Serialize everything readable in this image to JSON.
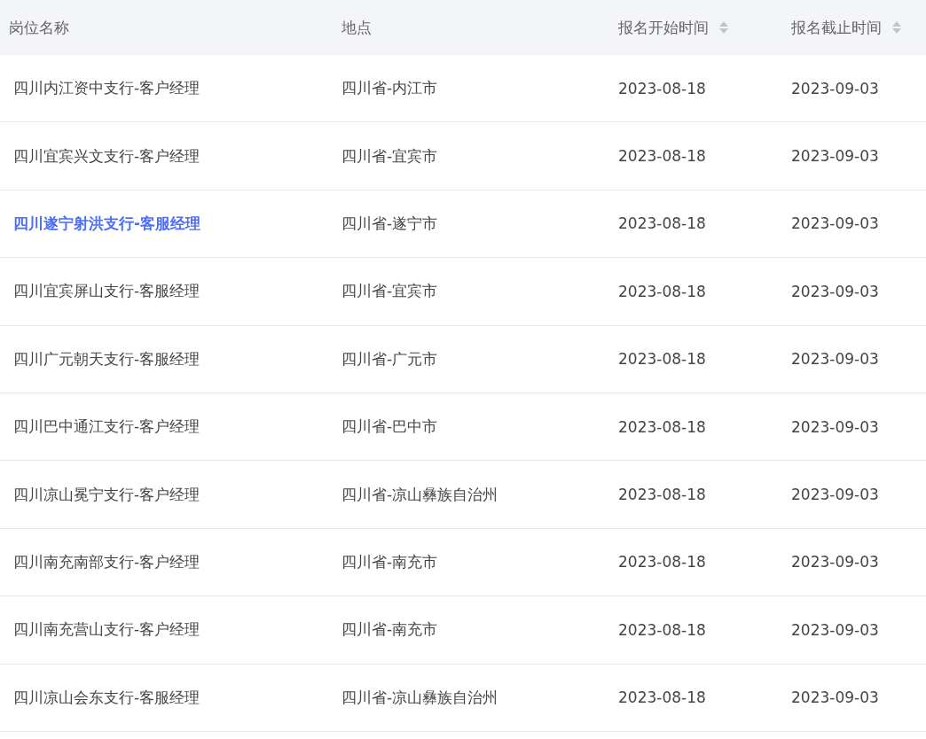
{
  "table": {
    "columns": [
      {
        "label": "岗位名称",
        "sortable": false
      },
      {
        "label": "地点",
        "sortable": false
      },
      {
        "label": "报名开始时间",
        "sortable": true
      },
      {
        "label": "报名截止时间",
        "sortable": true
      }
    ],
    "rows": [
      {
        "position": "四川内江资中支行-客户经理",
        "location": "四川省-内江市",
        "start": "2023-08-18",
        "end": "2023-09-03",
        "selected": false
      },
      {
        "position": "四川宜宾兴文支行-客户经理",
        "location": "四川省-宜宾市",
        "start": "2023-08-18",
        "end": "2023-09-03",
        "selected": false
      },
      {
        "position": "四川遂宁射洪支行-客服经理",
        "location": "四川省-遂宁市",
        "start": "2023-08-18",
        "end": "2023-09-03",
        "selected": true
      },
      {
        "position": "四川宜宾屏山支行-客服经理",
        "location": "四川省-宜宾市",
        "start": "2023-08-18",
        "end": "2023-09-03",
        "selected": false
      },
      {
        "position": "四川广元朝天支行-客服经理",
        "location": "四川省-广元市",
        "start": "2023-08-18",
        "end": "2023-09-03",
        "selected": false
      },
      {
        "position": "四川巴中通江支行-客户经理",
        "location": "四川省-巴中市",
        "start": "2023-08-18",
        "end": "2023-09-03",
        "selected": false
      },
      {
        "position": "四川凉山冕宁支行-客户经理",
        "location": "四川省-凉山彝族自治州",
        "start": "2023-08-18",
        "end": "2023-09-03",
        "selected": false
      },
      {
        "position": "四川南充南部支行-客户经理",
        "location": "四川省-南充市",
        "start": "2023-08-18",
        "end": "2023-09-03",
        "selected": false
      },
      {
        "position": "四川南充营山支行-客户经理",
        "location": "四川省-南充市",
        "start": "2023-08-18",
        "end": "2023-09-03",
        "selected": false
      },
      {
        "position": "四川凉山会东支行-客服经理",
        "location": "四川省-凉山彝族自治州",
        "start": "2023-08-18",
        "end": "2023-09-03",
        "selected": false
      }
    ]
  }
}
